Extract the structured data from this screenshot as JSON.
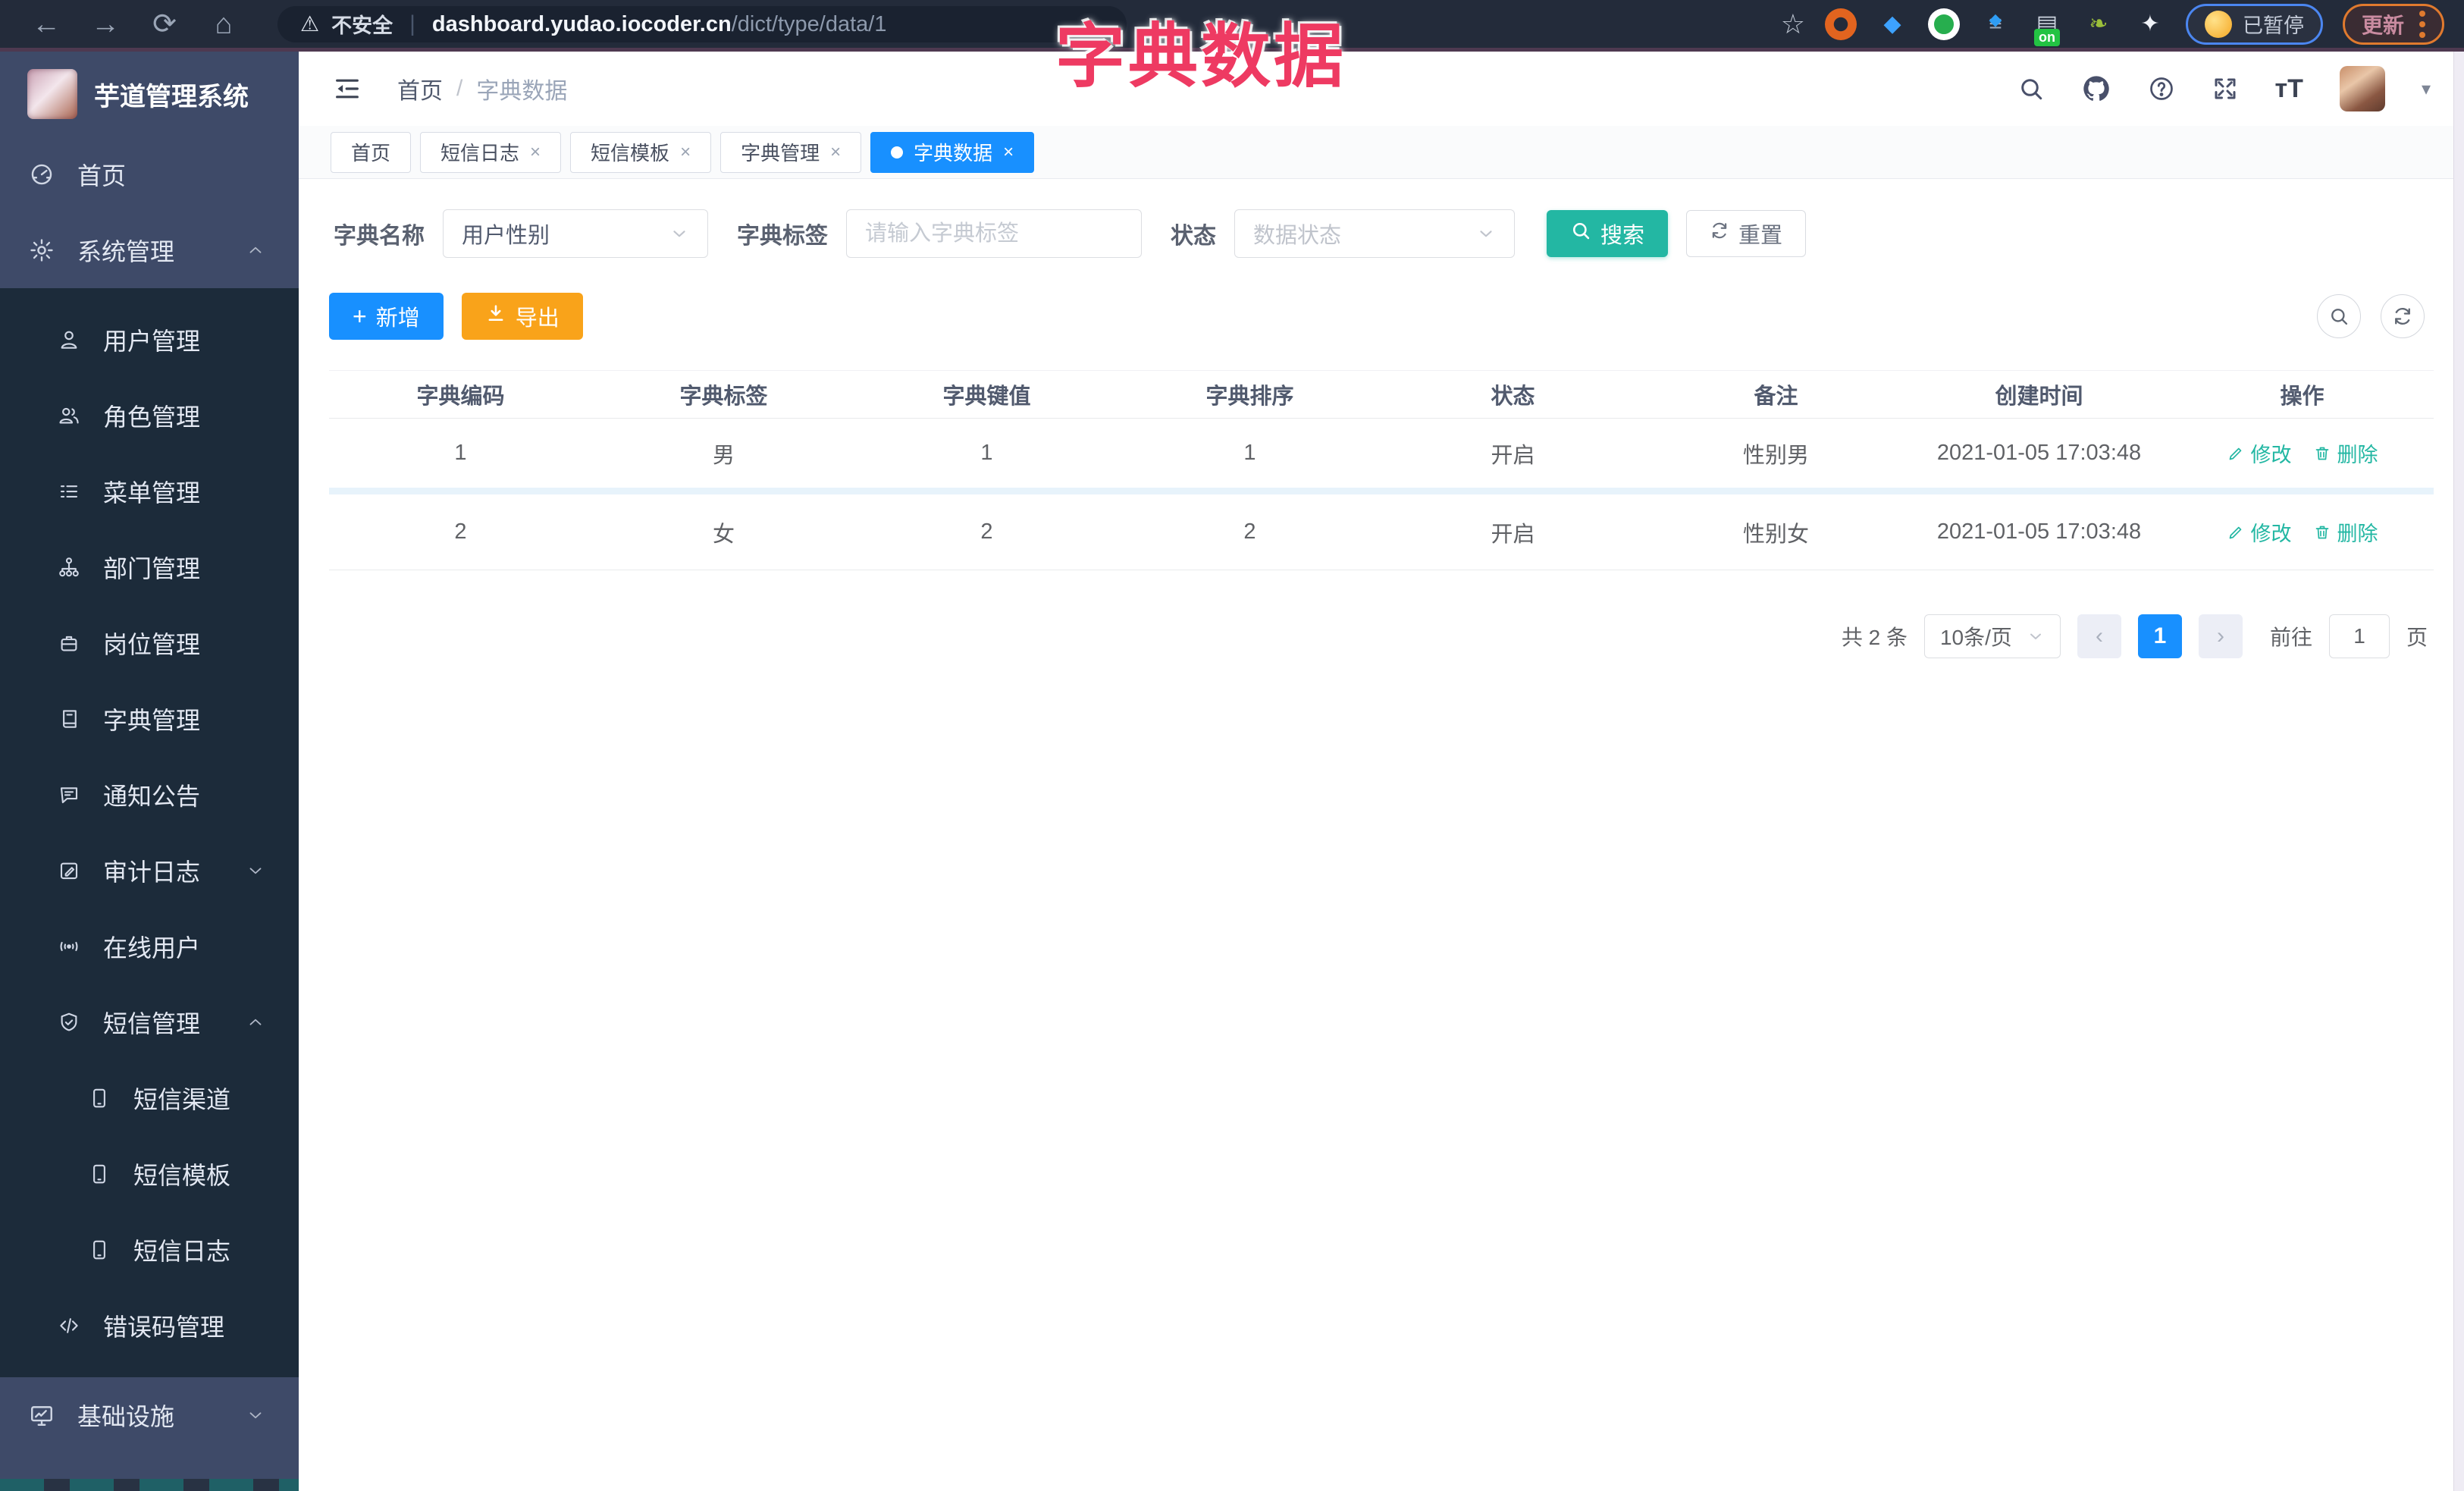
{
  "browser": {
    "back": "←",
    "forward": "→",
    "reload": "⟳",
    "home": "⌂",
    "security_label": "不安全",
    "url_host": "dashboard.yudao.iocoder.cn",
    "url_path": "/dict/type/data/1",
    "bookmark_star": "☆",
    "paused_label": "已暂停",
    "update_label": "更新"
  },
  "overlay_title": "字典数据",
  "sidebar": {
    "title": "芋道管理系统",
    "items": [
      {
        "label": "首页",
        "icon": "dashboard-icon",
        "level": 1,
        "zone": "base"
      },
      {
        "label": "系统管理",
        "icon": "gear-icon",
        "level": 1,
        "zone": "base",
        "caret": "up"
      },
      {
        "label": "用户管理",
        "icon": "user-icon",
        "level": 2,
        "zone": "dark"
      },
      {
        "label": "角色管理",
        "icon": "users-icon",
        "level": 2,
        "zone": "dark"
      },
      {
        "label": "菜单管理",
        "icon": "menu-list-icon",
        "level": 2,
        "zone": "dark"
      },
      {
        "label": "部门管理",
        "icon": "org-tree-icon",
        "level": 2,
        "zone": "dark"
      },
      {
        "label": "岗位管理",
        "icon": "badge-icon",
        "level": 2,
        "zone": "dark"
      },
      {
        "label": "字典管理",
        "icon": "dictionary-icon",
        "level": 2,
        "zone": "dark"
      },
      {
        "label": "通知公告",
        "icon": "announcement-icon",
        "level": 2,
        "zone": "dark"
      },
      {
        "label": "审计日志",
        "icon": "audit-log-icon",
        "level": 2,
        "zone": "dark",
        "caret": "down"
      },
      {
        "label": "在线用户",
        "icon": "online-user-icon",
        "level": 2,
        "zone": "dark"
      },
      {
        "label": "短信管理",
        "icon": "sms-shield-icon",
        "level": 2,
        "zone": "dark",
        "caret": "up"
      },
      {
        "label": "短信渠道",
        "icon": "phone-icon",
        "level": 3,
        "zone": "dark"
      },
      {
        "label": "短信模板",
        "icon": "phone-icon",
        "level": 3,
        "zone": "dark"
      },
      {
        "label": "短信日志",
        "icon": "phone-icon",
        "level": 3,
        "zone": "dark"
      },
      {
        "label": "错误码管理",
        "icon": "code-icon",
        "level": 2,
        "zone": "dark"
      },
      {
        "label": "基础设施",
        "icon": "monitor-icon",
        "level": 1,
        "zone": "base",
        "caret": "down"
      }
    ]
  },
  "header": {
    "breadcrumb_home": "首页",
    "breadcrumb_sep": "/",
    "breadcrumb_current": "字典数据"
  },
  "tabs": [
    {
      "label": "首页",
      "closable": false,
      "active": false
    },
    {
      "label": "短信日志",
      "closable": true,
      "active": false
    },
    {
      "label": "短信模板",
      "closable": true,
      "active": false
    },
    {
      "label": "字典管理",
      "closable": true,
      "active": false
    },
    {
      "label": "字典数据",
      "closable": true,
      "active": true
    }
  ],
  "filters": {
    "name_label": "字典名称",
    "name_value": "用户性别",
    "tag_label": "字典标签",
    "tag_placeholder": "请输入字典标签",
    "status_label": "状态",
    "status_placeholder": "数据状态",
    "search_label": "搜索",
    "reset_label": "重置"
  },
  "toolbar": {
    "add_label": "新增",
    "export_label": "导出"
  },
  "table": {
    "columns": [
      "字典编码",
      "字典标签",
      "字典键值",
      "字典排序",
      "状态",
      "备注",
      "创建时间",
      "操作"
    ],
    "rows": [
      [
        "1",
        "男",
        "1",
        "1",
        "开启",
        "性别男",
        "2021-01-05 17:03:48"
      ],
      [
        "2",
        "女",
        "2",
        "2",
        "开启",
        "性别女",
        "2021-01-05 17:03:48"
      ]
    ],
    "edit_label": "修改",
    "delete_label": "删除"
  },
  "pagination": {
    "total": "共 2 条",
    "page_size": "10条/页",
    "current": "1",
    "goto_label": "前往",
    "goto_value": "1",
    "page_label": "页"
  },
  "colors": {
    "primary_blue": "#1890ff",
    "theme_teal": "#23b7a3",
    "export_orange": "#f9a31a",
    "annotation_pink": "#ee3a62"
  }
}
